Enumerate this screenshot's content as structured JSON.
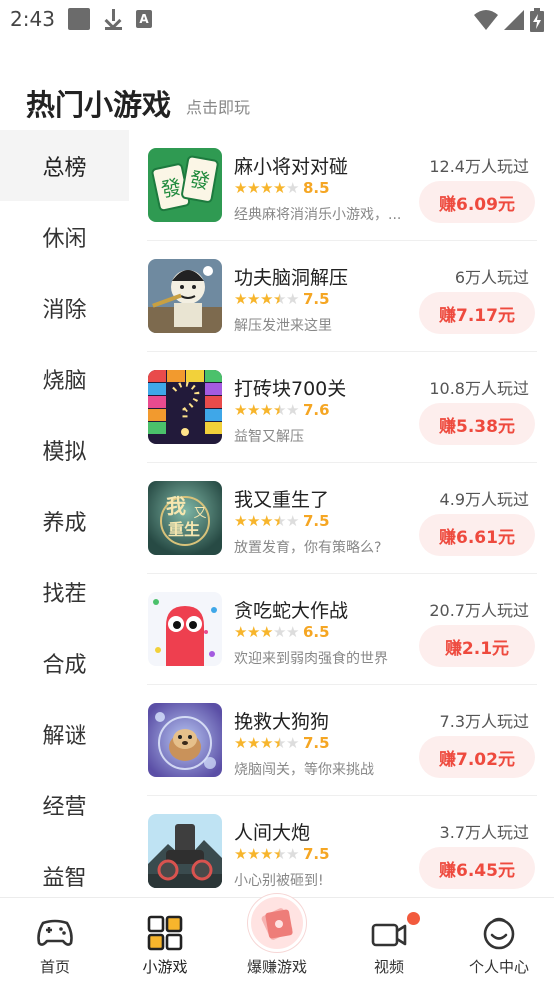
{
  "status_bar": {
    "time": "2:43",
    "icons": [
      "stop-square-icon",
      "download-icon",
      "a-badge-icon",
      "wifi-icon",
      "signal-icon",
      "battery-charging-icon"
    ]
  },
  "header": {
    "title": "热门小游戏",
    "subtitle": "点击即玩"
  },
  "sidebar": {
    "items": [
      {
        "label": "总榜",
        "active": true
      },
      {
        "label": "休闲"
      },
      {
        "label": "消除"
      },
      {
        "label": "烧脑"
      },
      {
        "label": "模拟"
      },
      {
        "label": "养成"
      },
      {
        "label": "找茬"
      },
      {
        "label": "合成"
      },
      {
        "label": "解谜"
      },
      {
        "label": "经营"
      },
      {
        "label": "益智"
      }
    ]
  },
  "games": [
    {
      "name": "麻小将对对碰",
      "rating": 8.5,
      "stars": 4,
      "score": "8.5",
      "desc": "经典麻将消消乐小游戏，...",
      "players": "12.4万人玩过",
      "reward": "赚6.09元",
      "icon": "mahjong-icon"
    },
    {
      "name": "功夫脑洞解压",
      "rating": 7.5,
      "stars": 3.5,
      "score": "7.5",
      "desc": "解压发泄来这里",
      "players": "6万人玩过",
      "reward": "赚7.17元",
      "icon": "kungfu-meme-icon"
    },
    {
      "name": "打砖块700关",
      "rating": 7.6,
      "stars": 3.5,
      "score": "7.6",
      "desc": "益智又解压",
      "players": "10.8万人玩过",
      "reward": "赚5.38元",
      "icon": "brick-breaker-icon"
    },
    {
      "name": "我又重生了",
      "rating": 7.5,
      "stars": 3.5,
      "score": "7.5",
      "desc": "放置发育，你有策略么?",
      "players": "4.9万人玩过",
      "reward": "赚6.61元",
      "icon": "reborn-logo-icon"
    },
    {
      "name": "贪吃蛇大作战",
      "rating": 6.5,
      "stars": 3,
      "score": "6.5",
      "desc": "欢迎来到弱肉强食的世界",
      "players": "20.7万人玩过",
      "reward": "赚2.1元",
      "icon": "snake-monster-icon"
    },
    {
      "name": "挽救大狗狗",
      "rating": 7.5,
      "stars": 3.5,
      "score": "7.5",
      "desc": "烧脑闯关，等你来挑战",
      "players": "7.3万人玩过",
      "reward": "赚7.02元",
      "icon": "dog-bubble-icon"
    },
    {
      "name": "人间大炮",
      "rating": 7.5,
      "stars": 3.5,
      "score": "7.5",
      "desc": "小心别被砸到!",
      "players": "3.7万人玩过",
      "reward": "赚6.45元",
      "icon": "cannon-icon"
    }
  ],
  "bottom_nav": {
    "items": [
      {
        "label": "首页",
        "icon": "gamepad-icon"
      },
      {
        "label": "小游戏",
        "icon": "grid-icon",
        "active": true
      },
      {
        "label": "爆赚游戏",
        "icon": "cash-icon",
        "featured": true
      },
      {
        "label": "视频",
        "icon": "video-camera-icon",
        "badge": true
      },
      {
        "label": "个人中心",
        "icon": "smiley-icon"
      }
    ]
  },
  "colors": {
    "accent_red": "#ee4a3e",
    "reward_bg": "#fdeeed",
    "star": "#f7b52c",
    "score": "#f5a623",
    "sidebar_active_bg": "#f4f4f4"
  }
}
